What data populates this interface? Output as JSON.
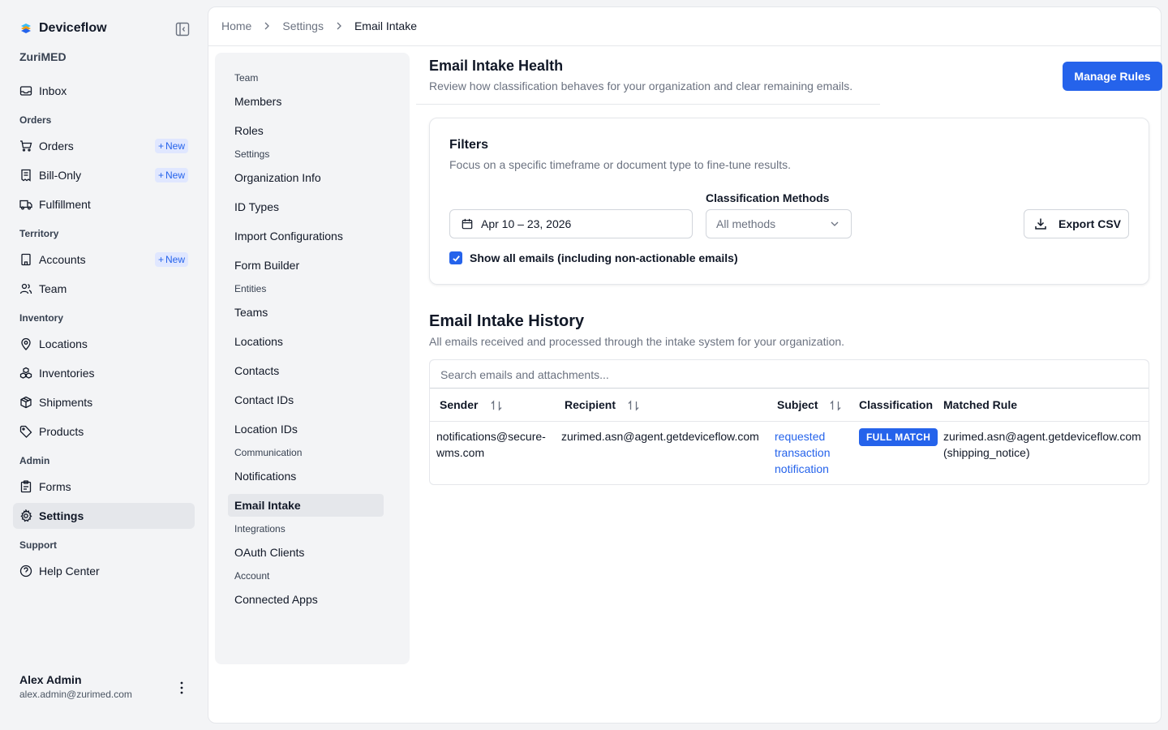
{
  "app": {
    "name": "Deviceflow",
    "org": "ZuriMED"
  },
  "sidebar": {
    "inbox": "Inbox",
    "orders_section": "Orders",
    "orders": "Orders",
    "bill_only": "Bill-Only",
    "fulfillment": "Fulfillment",
    "territory_section": "Territory",
    "accounts": "Accounts",
    "team": "Team",
    "inventory_section": "Inventory",
    "locations": "Locations",
    "inventories": "Inventories",
    "shipments": "Shipments",
    "products": "Products",
    "admin_section": "Admin",
    "forms": "Forms",
    "settings": "Settings",
    "support_section": "Support",
    "help_center": "Help Center",
    "new_badge": "New"
  },
  "user": {
    "name": "Alex Admin",
    "email": "alex.admin@zurimed.com"
  },
  "breadcrumb": {
    "home": "Home",
    "settings": "Settings",
    "current": "Email Intake"
  },
  "settings_nav": {
    "team_section": "Team",
    "members": "Members",
    "roles": "Roles",
    "settings_section": "Settings",
    "org_info": "Organization Info",
    "id_types": "ID Types",
    "import_configs": "Import Configurations",
    "form_builder": "Form Builder",
    "entities_section": "Entities",
    "teams": "Teams",
    "locations": "Locations",
    "contacts": "Contacts",
    "contact_ids": "Contact IDs",
    "location_ids": "Location IDs",
    "communication_section": "Communication",
    "notifications": "Notifications",
    "email_intake": "Email Intake",
    "integrations_section": "Integrations",
    "oauth_clients": "OAuth Clients",
    "account_section": "Account",
    "connected_apps": "Connected Apps"
  },
  "health": {
    "title": "Email Intake Health",
    "subtitle": "Review how classification behaves for your organization and clear remaining emails.",
    "manage_rules": "Manage Rules"
  },
  "filters": {
    "title": "Filters",
    "subtitle": "Focus on a specific timeframe or document type to fine-tune results.",
    "date_range": "Apr 10 – 23, 2026",
    "methods_label": "Classification Methods",
    "methods_value": "All methods",
    "export": "Export CSV",
    "show_all": "Show all emails (including non-actionable emails)",
    "show_all_checked": true
  },
  "history": {
    "title": "Email Intake History",
    "subtitle": "All emails received and processed through the intake system for your organization.",
    "search_placeholder": "Search emails and attachments...",
    "columns": {
      "sender": "Sender",
      "recipient": "Recipient",
      "subject": "Subject",
      "classification": "Classification",
      "matched_rule": "Matched Rule"
    },
    "rows": [
      {
        "sender_l1": "notifications@secure-",
        "sender_l2": "wms.com",
        "recipient": "zurimed.asn@agent.getdeviceflow.com",
        "subject_l1": "requested",
        "subject_l2": "transaction",
        "subject_l3": "notification",
        "classification": "FULL MATCH",
        "rule_l1": "zurimed.asn@agent.getdeviceflow.com",
        "rule_l2": "(shipping_notice)"
      }
    ]
  },
  "colors": {
    "accent": "#2563eb",
    "active_bg": "#e5e7eb",
    "badge_bg": "#e0e7ff"
  }
}
